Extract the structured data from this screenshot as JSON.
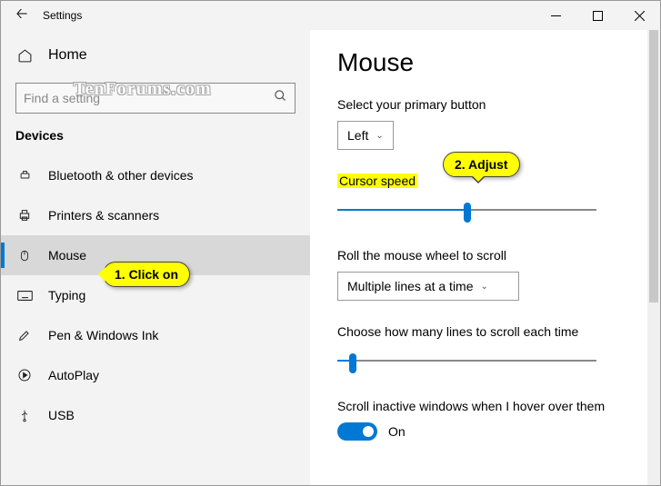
{
  "titlebar": {
    "title": "Settings"
  },
  "sidebar": {
    "home": "Home",
    "search_placeholder": "Find a setting",
    "category": "Devices",
    "items": [
      {
        "label": "Bluetooth & other devices"
      },
      {
        "label": "Printers & scanners"
      },
      {
        "label": "Mouse"
      },
      {
        "label": "Typing"
      },
      {
        "label": "Pen & Windows Ink"
      },
      {
        "label": "AutoPlay"
      },
      {
        "label": "USB"
      }
    ]
  },
  "main": {
    "heading": "Mouse",
    "primary_label": "Select your primary button",
    "primary_value": "Left",
    "cursor_speed_label": "Cursor speed",
    "roll_label": "Roll the mouse wheel to scroll",
    "roll_value": "Multiple lines at a time",
    "lines_label": "Choose how many lines to scroll each time",
    "inactive_label": "Scroll inactive windows when I hover over them",
    "toggle_state": "On"
  },
  "callouts": {
    "click_on": "1. Click on",
    "adjust": "2. Adjust"
  },
  "watermark": "TenForums.com"
}
